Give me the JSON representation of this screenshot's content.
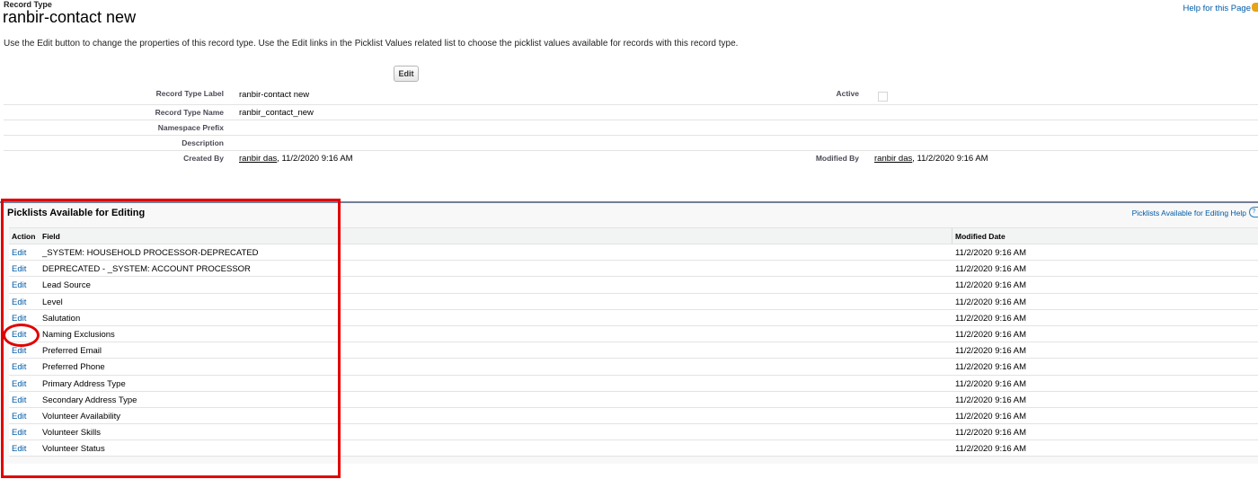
{
  "header": {
    "eyebrow": "Record Type",
    "title": "ranbir-contact new",
    "help_link": "Help for this Page"
  },
  "intro_text": "Use the Edit button to change the properties of this record type. Use the Edit links in the Picklist Values related list to choose the picklist values available for records with this record type.",
  "toolbar": {
    "edit_label": "Edit"
  },
  "details": {
    "record_type_label": {
      "label": "Record Type Label",
      "value": "ranbir-contact new"
    },
    "active": {
      "label": "Active",
      "checked": false
    },
    "record_type_name": {
      "label": "Record Type Name",
      "value": "ranbir_contact_new"
    },
    "namespace_prefix": {
      "label": "Namespace Prefix",
      "value": ""
    },
    "description": {
      "label": "Description",
      "value": ""
    },
    "created_by": {
      "label": "Created By",
      "user": "ranbir das",
      "date": ", 11/2/2020 9:16 AM"
    },
    "modified_by": {
      "label": "Modified By",
      "user": "ranbir das",
      "date": ", 11/2/2020 9:16 AM"
    }
  },
  "picklists": {
    "title": "Picklists Available for Editing",
    "help_link": "Picklists Available for Editing Help",
    "help_icon": "?",
    "columns": {
      "action": "Action",
      "field": "Field",
      "modified": "Modified Date"
    },
    "rows": [
      {
        "action": "Edit",
        "field": "_SYSTEM: HOUSEHOLD PROCESSOR-DEPRECATED",
        "modified": "11/2/2020 9:16 AM"
      },
      {
        "action": "Edit",
        "field": "DEPRECATED - _SYSTEM: ACCOUNT PROCESSOR",
        "modified": "11/2/2020 9:16 AM"
      },
      {
        "action": "Edit",
        "field": "Lead Source",
        "modified": "11/2/2020 9:16 AM"
      },
      {
        "action": "Edit",
        "field": "Level",
        "modified": "11/2/2020 9:16 AM"
      },
      {
        "action": "Edit",
        "field": "Salutation",
        "modified": "11/2/2020 9:16 AM"
      },
      {
        "action": "Edit",
        "field": "Naming Exclusions",
        "modified": "11/2/2020 9:16 AM"
      },
      {
        "action": "Edit",
        "field": "Preferred Email",
        "modified": "11/2/2020 9:16 AM"
      },
      {
        "action": "Edit",
        "field": "Preferred Phone",
        "modified": "11/2/2020 9:16 AM"
      },
      {
        "action": "Edit",
        "field": "Primary Address Type",
        "modified": "11/2/2020 9:16 AM"
      },
      {
        "action": "Edit",
        "field": "Secondary Address Type",
        "modified": "11/2/2020 9:16 AM"
      },
      {
        "action": "Edit",
        "field": "Volunteer Availability",
        "modified": "11/2/2020 9:16 AM"
      },
      {
        "action": "Edit",
        "field": "Volunteer Skills",
        "modified": "11/2/2020 9:16 AM"
      },
      {
        "action": "Edit",
        "field": "Volunteer Status",
        "modified": "11/2/2020 9:16 AM"
      }
    ]
  },
  "colors": {
    "link": "#015ba7",
    "highlight": "#e10000",
    "section_border": "#747e96"
  }
}
